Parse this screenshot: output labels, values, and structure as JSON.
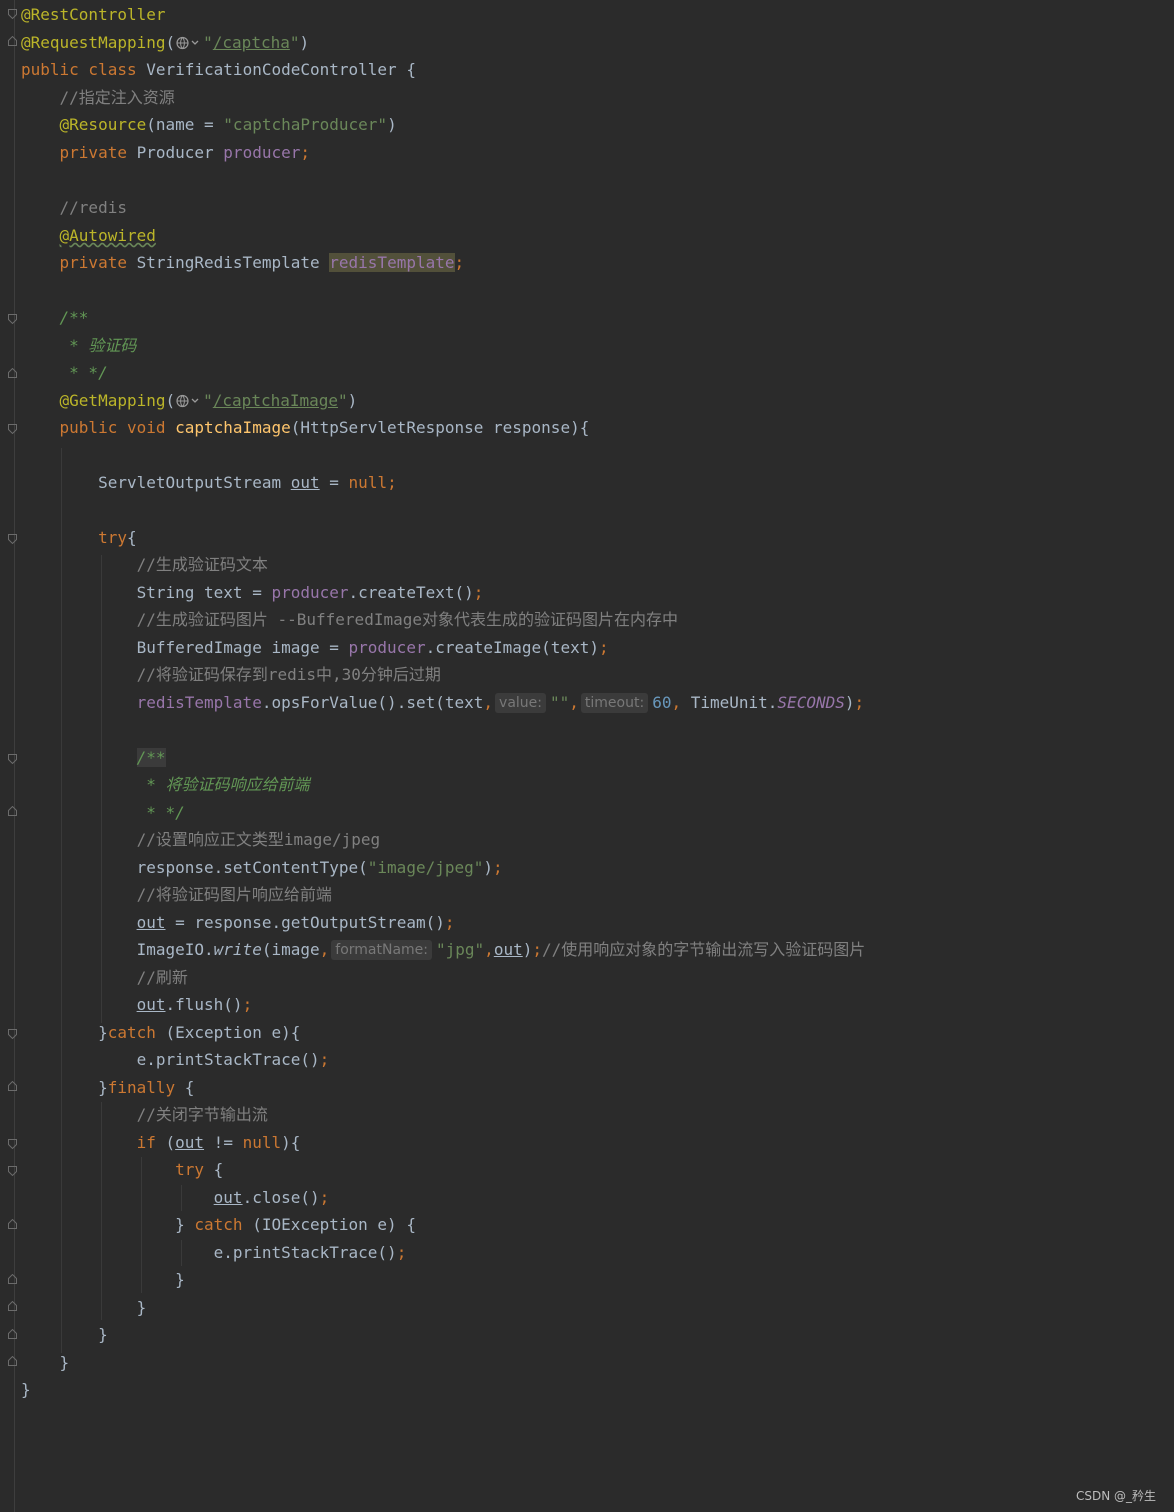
{
  "code": {
    "l1": "@RestController",
    "l2_ann": "@RequestMapping",
    "l2_url": "/captcha",
    "l3_class_name": "VerificationCodeController",
    "l4_comment": "//指定注入资源",
    "l5_ann": "@Resource",
    "l5_str": "\"captchaProducer\"",
    "l6_type": "Producer",
    "l6_field": "producer",
    "l8_comment": "//redis",
    "l9_ann": "@Autowired",
    "l10_type": "StringRedisTemplate",
    "l10_field": "redisTemplate",
    "l13_doc": " * 验证码",
    "l15_ann": "@GetMapping",
    "l15_url": "/captchaImage",
    "l16_method": "captchaImage",
    "l16_params": "(HttpServletResponse response){",
    "l18_type": "ServletOutputStream",
    "l21_comment": "//生成验证码文本",
    "l23_comment": "//生成验证码图片 --BufferedImage对象代表生成的验证码图片在内存中",
    "l25_comment": "//将验证码保存到redis中,30分钟后过期",
    "l26_hint_value": "value:",
    "l26_hint_timeout": "timeout:",
    "l26_timeout": "60",
    "l26_unit": "SECONDS",
    "l29_doc": " * 将验证码响应给前端",
    "l31_comment": "//设置响应正文类型image/jpeg",
    "l32_mime": "\"image/jpeg\"",
    "l33_comment": "//将验证码图片响应给前端",
    "l35_hint": "formatName:",
    "l35_fmt": "\"jpg\"",
    "l35_comment": "//使用响应对象的字节输出流写入验证码图片",
    "l36_comment": "//刷新",
    "l41_comment": "//关闭字节输出流"
  },
  "watermark": "CSDN @_矜生"
}
